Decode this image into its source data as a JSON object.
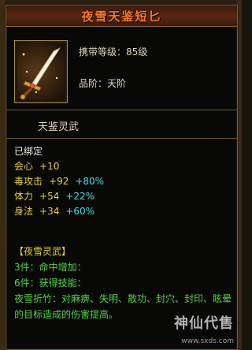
{
  "item": {
    "title": "夜雪天鉴短匕",
    "carry_label": "携带等级：",
    "carry_value": "85级",
    "grade_label": "品阶：",
    "grade_value": "天阶",
    "icon": "dagger-icon"
  },
  "section_header": "天鉴灵武",
  "stats": {
    "bound": "已绑定",
    "rows": [
      {
        "label": "会心",
        "value": "+10",
        "bonus": ""
      },
      {
        "label": "毒攻击",
        "value": "+92",
        "bonus": "+80%"
      },
      {
        "label": "体力",
        "value": "+54",
        "bonus": "+22%"
      },
      {
        "label": "身法",
        "value": "+34",
        "bonus": "+60%"
      }
    ]
  },
  "set": {
    "title": "【夜雪灵武】",
    "piece3": "3件：命中增加：",
    "piece6": "6件：获得技能：",
    "desc": "夜雪折竹：对麻痹、失明、散功、封穴、封印、眩晕的目标造成的伤害提高。"
  },
  "watermark": {
    "text": "神仙代售",
    "url": "www.sxds.com"
  },
  "colors": {
    "title": "#ff7a2a",
    "stat_yellow": "#e4d040",
    "stat_cyan": "#40e0e0",
    "set_green": "#54d04a",
    "border": "#6a5530"
  }
}
